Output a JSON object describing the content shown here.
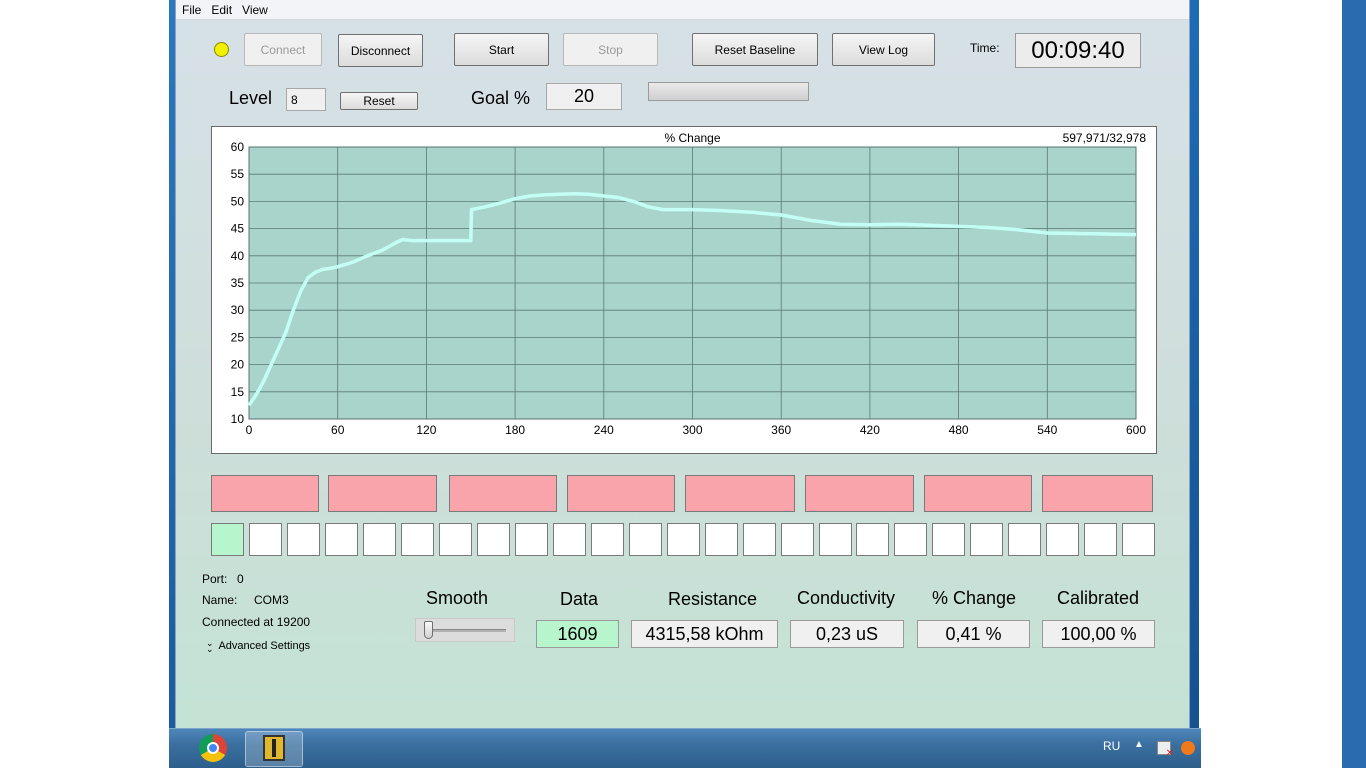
{
  "menu": {
    "file": "File",
    "edit": "Edit",
    "view": "View"
  },
  "toolbar": {
    "connect": "Connect",
    "disconnect": "Disconnect",
    "start": "Start",
    "stop": "Stop",
    "reset_baseline": "Reset Baseline",
    "view_log": "View Log",
    "time_label": "Time:",
    "time_value": "00:09:40",
    "status_led_color": "#f0f000"
  },
  "level": {
    "label": "Level",
    "value": "8",
    "reset": "Reset"
  },
  "goal": {
    "label": "Goal %",
    "value": "20",
    "progress": 0
  },
  "chart_data": {
    "type": "line",
    "title": "% Change",
    "counter": "597,971/32,978",
    "xlabel": "",
    "ylabel": "",
    "xlim": [
      0,
      600
    ],
    "ylim": [
      10,
      60
    ],
    "xticks": [
      0,
      60,
      120,
      180,
      240,
      300,
      360,
      420,
      480,
      540,
      600
    ],
    "yticks": [
      10,
      15,
      20,
      25,
      30,
      35,
      40,
      45,
      50,
      55,
      60
    ],
    "grid": true,
    "background": "#a9d4cc",
    "line_color": "#c4fff6",
    "series": [
      {
        "x": [
          0,
          5,
          10,
          15,
          20,
          25,
          30,
          35,
          40,
          45,
          50,
          55,
          60,
          70,
          80,
          90,
          100,
          104,
          110,
          120,
          130,
          140,
          150,
          150.5,
          160,
          170,
          180,
          190,
          200,
          210,
          220,
          230,
          240,
          250,
          260,
          270,
          280,
          300,
          320,
          340,
          360,
          380,
          400,
          420,
          440,
          460,
          480,
          500,
          520,
          540,
          560,
          580,
          600
        ],
        "y": [
          12.5,
          14.5,
          17,
          20,
          23,
          26,
          30,
          33.5,
          36,
          37,
          37.5,
          37.7,
          38,
          38.8,
          40,
          41,
          42.5,
          43,
          42.8,
          42.8,
          42.8,
          42.8,
          42.8,
          48.5,
          49,
          49.7,
          50.5,
          51,
          51.2,
          51.3,
          51.4,
          51.3,
          51,
          50.7,
          50,
          49,
          48.5,
          48.5,
          48.3,
          48,
          47.5,
          46.5,
          45.8,
          45.7,
          45.8,
          45.6,
          45.4,
          45.2,
          44.8,
          44.2,
          44.1,
          44,
          43.9
        ]
      }
    ]
  },
  "indicators": {
    "top_blocks": 8,
    "cells": 25,
    "active_cells": 1,
    "top_color": "#f9a3ab",
    "active_color": "#b7f5cc"
  },
  "port": {
    "port_label": "Port:",
    "port_value": "0",
    "name_label": "Name:",
    "name_value": "COM3",
    "status": "Connected at 19200",
    "advanced": "Advanced Settings"
  },
  "readouts": {
    "smooth_label": "Smooth",
    "smooth_level": 0,
    "data_label": "Data",
    "data_value": "1609",
    "data_color": "#b7f5cc",
    "resistance_label": "Resistance",
    "resistance_value": "4315,58 kOhm",
    "conductivity_label": "Conductivity",
    "conductivity_value": "0,23 uS",
    "change_label": "% Change",
    "change_value": "0,41 %",
    "calibrated_label": "Calibrated",
    "calibrated_value": "100,00 %"
  },
  "taskbar": {
    "language": "RU"
  }
}
